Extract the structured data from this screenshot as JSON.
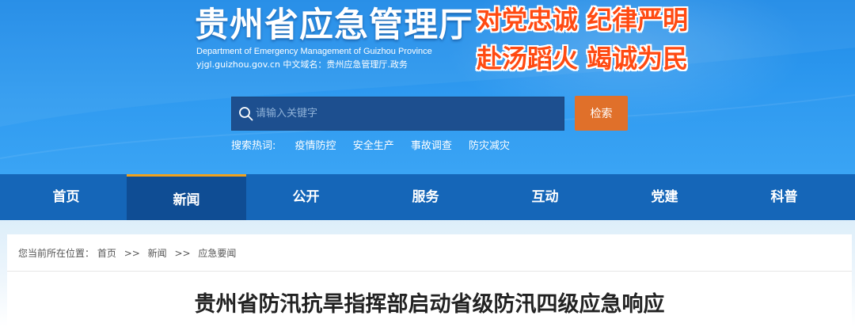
{
  "header": {
    "title": "贵州省应急管理厅",
    "subtitle_en": "Department of Emergency Management of Guizhou Province",
    "domain": "yjgl.guizhou.gov.cn 中文域名：贵州应急管理厅.政务",
    "slogan_line1": "对党忠诚 纪律严明",
    "slogan_line2": "赴汤蹈火 竭诚为民"
  },
  "search": {
    "placeholder": "请输入关键字",
    "button_label": "检索",
    "hot_label": "搜索热词:",
    "hot_words": [
      "疫情防控",
      "安全生产",
      "事故调查",
      "防灾减灾"
    ]
  },
  "nav": {
    "items": [
      {
        "label": "首页"
      },
      {
        "label": "新闻"
      },
      {
        "label": "公开"
      },
      {
        "label": "服务"
      },
      {
        "label": "互动"
      },
      {
        "label": "党建"
      },
      {
        "label": "科普"
      }
    ],
    "active_index": 1
  },
  "breadcrumb": {
    "prefix": "您当前所在位置：",
    "separator": ">>",
    "items": [
      "首页",
      "新闻",
      "应急要闻"
    ]
  },
  "article": {
    "title": "贵州省防汛抗旱指挥部启动省级防汛四级应急响应"
  },
  "colors": {
    "header_blue": "#2f9af0",
    "nav_blue": "#1566b8",
    "nav_active": "#0f4d94",
    "nav_active_accent": "#f0a21e",
    "search_button": "#e0702a",
    "slogan_red": "#ff4a12"
  }
}
